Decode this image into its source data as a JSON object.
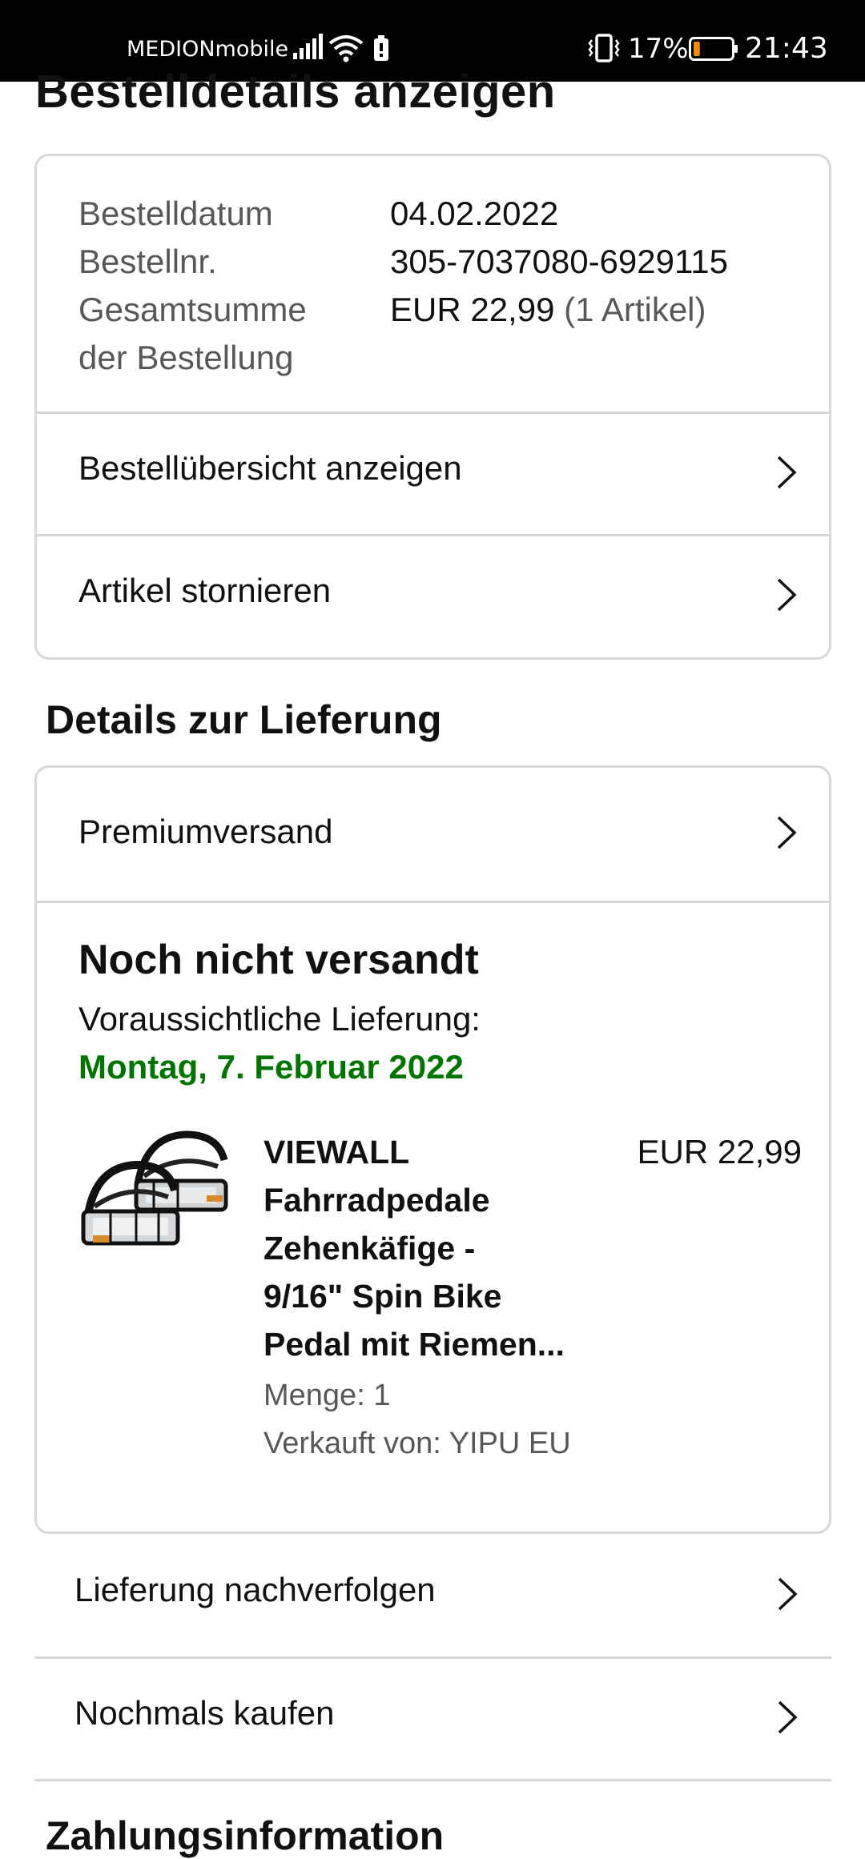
{
  "status_bar": {
    "carrier": "MEDIONmobile",
    "battery_percent": "17%",
    "battery_level": 0.17,
    "time": "21:43"
  },
  "page_title": "Bestelldetails anzeigen",
  "order_summary": {
    "date_label": "Bestelldatum",
    "date_value": "04.02.2022",
    "number_label": "Bestellnr.",
    "number_value": "305-7037080-6929115",
    "total_label_line1": "Gesamtsumme",
    "total_label_line2": "der Bestellung",
    "total_value": "EUR 22,99",
    "total_items": "(1 Artikel)"
  },
  "order_links": {
    "view_summary": "Bestellübersicht anzeigen",
    "cancel_items": "Artikel stornieren"
  },
  "delivery": {
    "section_title": "Details zur Lieferung",
    "shipping_method": "Premiumversand",
    "status": "Noch nicht versandt",
    "estimate_label": "Voraussichtliche Lieferung:",
    "estimate_date": "Montag, 7. Februar 2022"
  },
  "product": {
    "title_line1": "VIEWALL",
    "title_line2": "Fahrradpedale",
    "title_line3": "Zehenkäfige -",
    "title_line4": "9/16\" Spin Bike",
    "title_line5": "Pedal mit Riemen...",
    "price": "EUR 22,99",
    "quantity": "Menge: 1",
    "seller": "Verkauft von: YIPU EU"
  },
  "actions": {
    "track": "Lieferung nachverfolgen",
    "buy_again": "Nochmals kaufen"
  },
  "payment_section_title": "Zahlungsinformation",
  "colors": {
    "delivery_green": "#007600",
    "border": "#d5d9d9",
    "muted_text": "#565959",
    "battery_low": "#f08a00"
  }
}
